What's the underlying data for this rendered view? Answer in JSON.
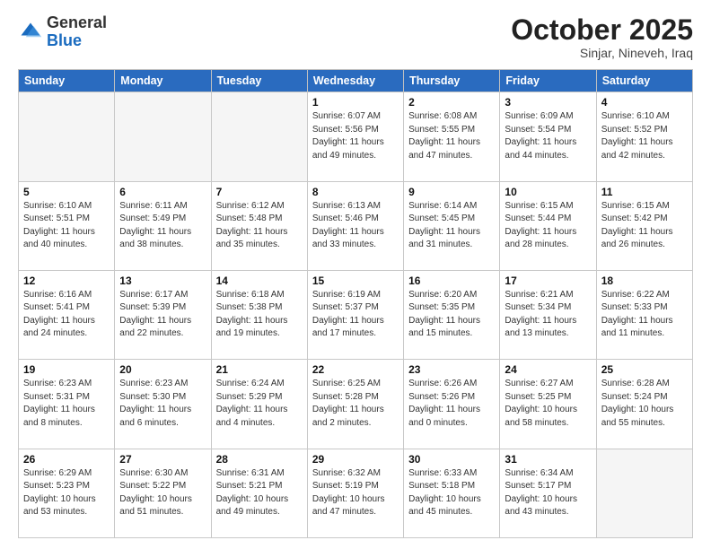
{
  "header": {
    "logo_general": "General",
    "logo_blue": "Blue",
    "month": "October 2025",
    "location": "Sinjar, Nineveh, Iraq"
  },
  "weekdays": [
    "Sunday",
    "Monday",
    "Tuesday",
    "Wednesday",
    "Thursday",
    "Friday",
    "Saturday"
  ],
  "weeks": [
    [
      {
        "day": "",
        "info": ""
      },
      {
        "day": "",
        "info": ""
      },
      {
        "day": "",
        "info": ""
      },
      {
        "day": "1",
        "info": "Sunrise: 6:07 AM\nSunset: 5:56 PM\nDaylight: 11 hours\nand 49 minutes."
      },
      {
        "day": "2",
        "info": "Sunrise: 6:08 AM\nSunset: 5:55 PM\nDaylight: 11 hours\nand 47 minutes."
      },
      {
        "day": "3",
        "info": "Sunrise: 6:09 AM\nSunset: 5:54 PM\nDaylight: 11 hours\nand 44 minutes."
      },
      {
        "day": "4",
        "info": "Sunrise: 6:10 AM\nSunset: 5:52 PM\nDaylight: 11 hours\nand 42 minutes."
      }
    ],
    [
      {
        "day": "5",
        "info": "Sunrise: 6:10 AM\nSunset: 5:51 PM\nDaylight: 11 hours\nand 40 minutes."
      },
      {
        "day": "6",
        "info": "Sunrise: 6:11 AM\nSunset: 5:49 PM\nDaylight: 11 hours\nand 38 minutes."
      },
      {
        "day": "7",
        "info": "Sunrise: 6:12 AM\nSunset: 5:48 PM\nDaylight: 11 hours\nand 35 minutes."
      },
      {
        "day": "8",
        "info": "Sunrise: 6:13 AM\nSunset: 5:46 PM\nDaylight: 11 hours\nand 33 minutes."
      },
      {
        "day": "9",
        "info": "Sunrise: 6:14 AM\nSunset: 5:45 PM\nDaylight: 11 hours\nand 31 minutes."
      },
      {
        "day": "10",
        "info": "Sunrise: 6:15 AM\nSunset: 5:44 PM\nDaylight: 11 hours\nand 28 minutes."
      },
      {
        "day": "11",
        "info": "Sunrise: 6:15 AM\nSunset: 5:42 PM\nDaylight: 11 hours\nand 26 minutes."
      }
    ],
    [
      {
        "day": "12",
        "info": "Sunrise: 6:16 AM\nSunset: 5:41 PM\nDaylight: 11 hours\nand 24 minutes."
      },
      {
        "day": "13",
        "info": "Sunrise: 6:17 AM\nSunset: 5:39 PM\nDaylight: 11 hours\nand 22 minutes."
      },
      {
        "day": "14",
        "info": "Sunrise: 6:18 AM\nSunset: 5:38 PM\nDaylight: 11 hours\nand 19 minutes."
      },
      {
        "day": "15",
        "info": "Sunrise: 6:19 AM\nSunset: 5:37 PM\nDaylight: 11 hours\nand 17 minutes."
      },
      {
        "day": "16",
        "info": "Sunrise: 6:20 AM\nSunset: 5:35 PM\nDaylight: 11 hours\nand 15 minutes."
      },
      {
        "day": "17",
        "info": "Sunrise: 6:21 AM\nSunset: 5:34 PM\nDaylight: 11 hours\nand 13 minutes."
      },
      {
        "day": "18",
        "info": "Sunrise: 6:22 AM\nSunset: 5:33 PM\nDaylight: 11 hours\nand 11 minutes."
      }
    ],
    [
      {
        "day": "19",
        "info": "Sunrise: 6:23 AM\nSunset: 5:31 PM\nDaylight: 11 hours\nand 8 minutes."
      },
      {
        "day": "20",
        "info": "Sunrise: 6:23 AM\nSunset: 5:30 PM\nDaylight: 11 hours\nand 6 minutes."
      },
      {
        "day": "21",
        "info": "Sunrise: 6:24 AM\nSunset: 5:29 PM\nDaylight: 11 hours\nand 4 minutes."
      },
      {
        "day": "22",
        "info": "Sunrise: 6:25 AM\nSunset: 5:28 PM\nDaylight: 11 hours\nand 2 minutes."
      },
      {
        "day": "23",
        "info": "Sunrise: 6:26 AM\nSunset: 5:26 PM\nDaylight: 11 hours\nand 0 minutes."
      },
      {
        "day": "24",
        "info": "Sunrise: 6:27 AM\nSunset: 5:25 PM\nDaylight: 10 hours\nand 58 minutes."
      },
      {
        "day": "25",
        "info": "Sunrise: 6:28 AM\nSunset: 5:24 PM\nDaylight: 10 hours\nand 55 minutes."
      }
    ],
    [
      {
        "day": "26",
        "info": "Sunrise: 6:29 AM\nSunset: 5:23 PM\nDaylight: 10 hours\nand 53 minutes."
      },
      {
        "day": "27",
        "info": "Sunrise: 6:30 AM\nSunset: 5:22 PM\nDaylight: 10 hours\nand 51 minutes."
      },
      {
        "day": "28",
        "info": "Sunrise: 6:31 AM\nSunset: 5:21 PM\nDaylight: 10 hours\nand 49 minutes."
      },
      {
        "day": "29",
        "info": "Sunrise: 6:32 AM\nSunset: 5:19 PM\nDaylight: 10 hours\nand 47 minutes."
      },
      {
        "day": "30",
        "info": "Sunrise: 6:33 AM\nSunset: 5:18 PM\nDaylight: 10 hours\nand 45 minutes."
      },
      {
        "day": "31",
        "info": "Sunrise: 6:34 AM\nSunset: 5:17 PM\nDaylight: 10 hours\nand 43 minutes."
      },
      {
        "day": "",
        "info": ""
      }
    ]
  ]
}
